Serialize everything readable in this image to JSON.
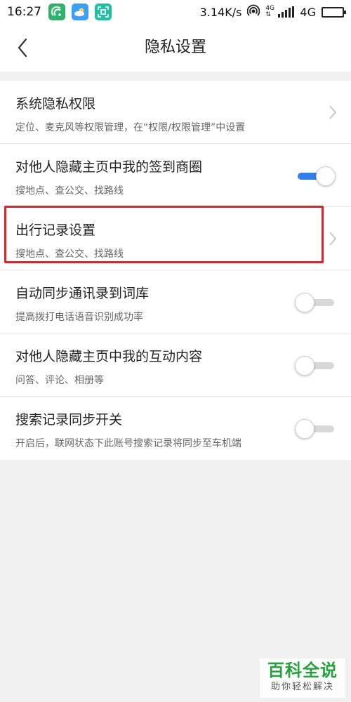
{
  "status_bar": {
    "time": "16:27",
    "net_speed": "3.14K/s",
    "network": "4G",
    "app_icons": [
      {
        "name": "radar-app-icon",
        "color": "#2fb36b"
      },
      {
        "name": "weather-app-icon",
        "color": "#3aa0ff"
      },
      {
        "name": "scan-app-icon",
        "color": "#1fc1a5"
      }
    ],
    "battery_level": 0.45
  },
  "nav": {
    "title": "隐私设置",
    "back_icon": "chevron-left-icon"
  },
  "settings": [
    {
      "title": "系统隐私权限",
      "desc": "定位、麦克风等权限管理，在“权限/权限管理”中设置",
      "control": "chevron"
    },
    {
      "title": "对他人隐藏主页中我的签到商圈",
      "desc": "搜地点、查公交、找路线",
      "control": "toggle",
      "on": true
    },
    {
      "title": "出行记录设置",
      "desc": "搜地点、查公交、找路线",
      "control": "chevron",
      "highlighted": true
    },
    {
      "title": "自动同步通讯录到词库",
      "desc": "提高拨打电话语音识别成功率",
      "control": "toggle",
      "on": false
    },
    {
      "title": "对他人隐藏主页中我的互动内容",
      "desc": "问答、评论、相册等",
      "control": "toggle",
      "on": false
    },
    {
      "title": "搜索记录同步开关",
      "desc": "开启后，联网状态下此账号搜索记录将同步至车机端",
      "control": "toggle",
      "on": false
    }
  ],
  "colors": {
    "toggle_on": "#2f7ff0",
    "highlight": "#d9262b",
    "watermark": "#23a33a"
  },
  "watermark": {
    "main": "百科全说",
    "sub": "助你轻松解决"
  }
}
